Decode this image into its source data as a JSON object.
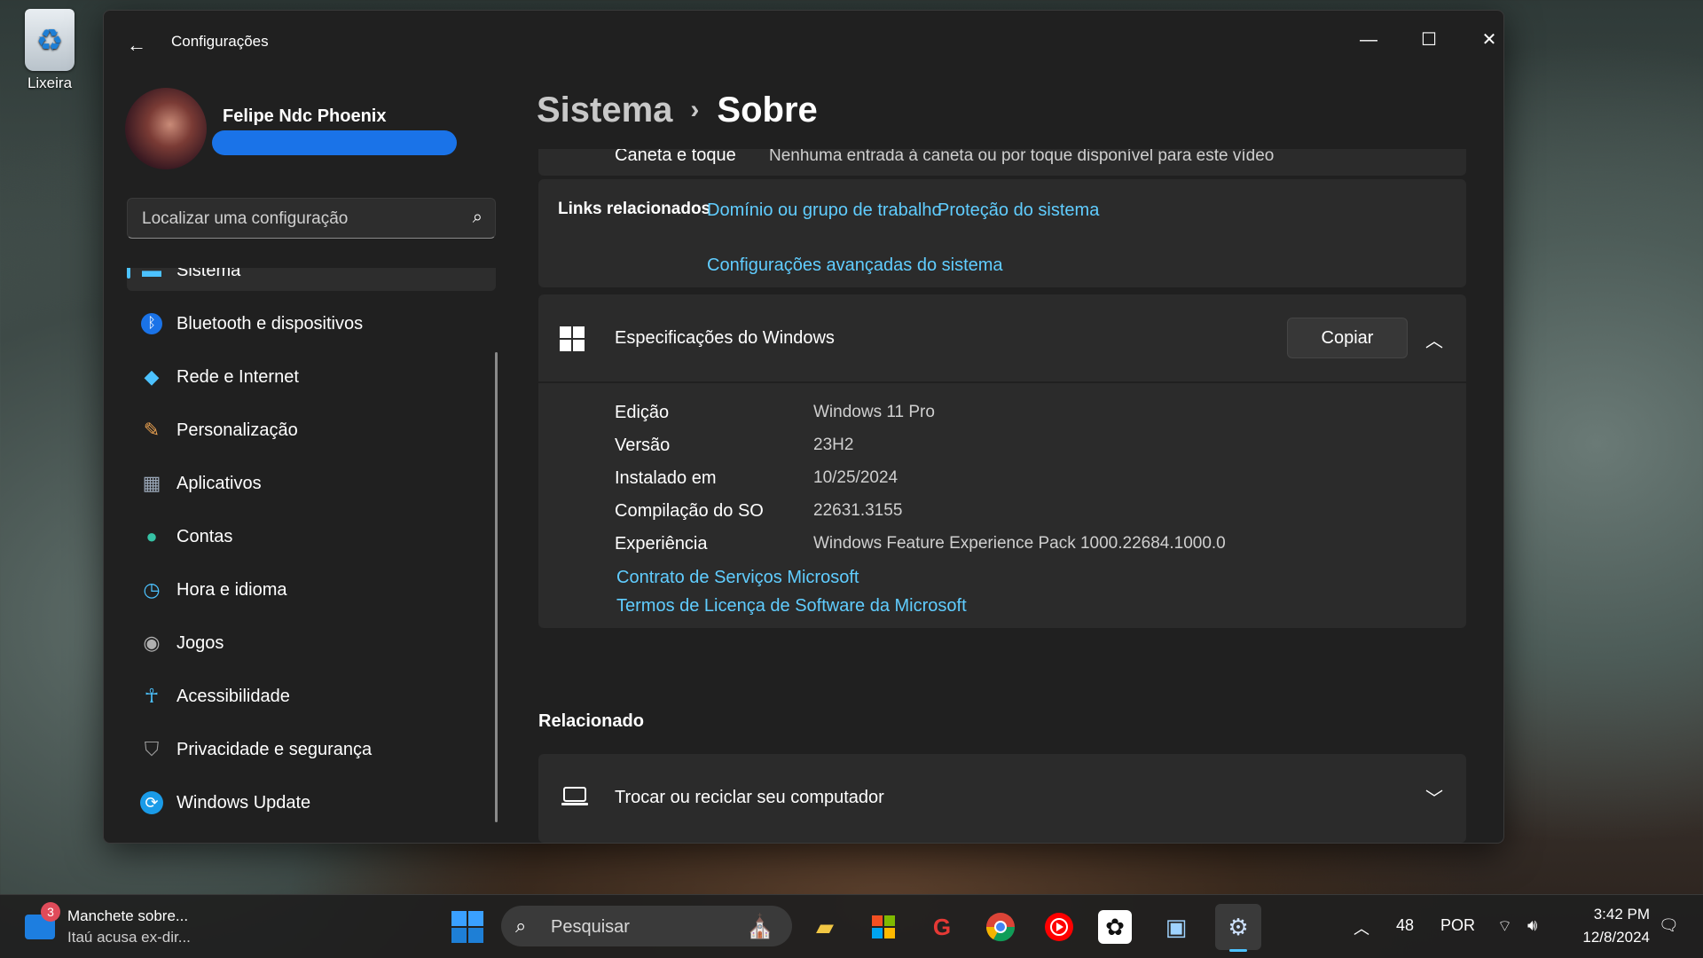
{
  "desktop": {
    "recycle_bin_label": "Lixeira"
  },
  "window": {
    "title": "Configurações",
    "controls": {
      "minimize": "—",
      "maximize": "☐",
      "close": "✕"
    }
  },
  "user": {
    "name": "Felipe Ndc Phoenix"
  },
  "search": {
    "placeholder": "Localizar uma configuração"
  },
  "nav": {
    "items": [
      {
        "label": "Sistema",
        "icon": "display-icon",
        "color": "#4cc2ff"
      },
      {
        "label": "Bluetooth e dispositivos",
        "icon": "bluetooth-icon",
        "color": "#1a73e8"
      },
      {
        "label": "Rede e Internet",
        "icon": "wifi-icon",
        "color": "#4cc2ff"
      },
      {
        "label": "Personalização",
        "icon": "brush-icon",
        "color": "#e8a050"
      },
      {
        "label": "Aplicativos",
        "icon": "apps-icon",
        "color": "#9aa7b8"
      },
      {
        "label": "Contas",
        "icon": "person-icon",
        "color": "#36c2a5"
      },
      {
        "label": "Hora e idioma",
        "icon": "clock-globe-icon",
        "color": "#4cc2ff"
      },
      {
        "label": "Jogos",
        "icon": "gamepad-icon",
        "color": "#b0b0b0"
      },
      {
        "label": "Acessibilidade",
        "icon": "accessibility-icon",
        "color": "#4cc2ff"
      },
      {
        "label": "Privacidade e segurança",
        "icon": "shield-icon",
        "color": "#9a9a9a"
      },
      {
        "label": "Windows Update",
        "icon": "update-icon",
        "color": "#1a9be8"
      }
    ]
  },
  "breadcrumb": {
    "parent": "Sistema",
    "separator": "›",
    "current": "Sobre"
  },
  "pen_row": {
    "label": "Caneta e toque",
    "value": "Nenhuma entrada à caneta ou por toque disponível para este vídeo"
  },
  "related_links": {
    "label": "Links relacionados",
    "links": [
      "Domínio ou grupo de trabalho",
      "Proteção do sistema",
      "Configurações avançadas do sistema"
    ]
  },
  "windows_specs": {
    "title": "Especificações do Windows",
    "copy_label": "Copiar",
    "rows": [
      {
        "label": "Edição",
        "value": "Windows 11 Pro"
      },
      {
        "label": "Versão",
        "value": "23H2"
      },
      {
        "label": "Instalado em",
        "value": "10/25/2024"
      },
      {
        "label": "Compilação do SO",
        "value": "22631.3155"
      },
      {
        "label": "Experiência",
        "value": "Windows Feature Experience Pack 1000.22684.1000.0"
      }
    ],
    "links": [
      "Contrato de Serviços Microsoft",
      "Termos de Licença de Software da Microsoft"
    ]
  },
  "related": {
    "title": "Relacionado",
    "item_label": "Trocar ou reciclar seu computador"
  },
  "taskbar": {
    "news": {
      "badge": "3",
      "title": "Manchete sobre...",
      "subtitle": "Itaú acusa ex-dir..."
    },
    "search_label": "Pesquisar",
    "tray": {
      "temperature": "48",
      "language": "POR",
      "time": "3:42 PM",
      "date": "12/8/2024"
    }
  }
}
